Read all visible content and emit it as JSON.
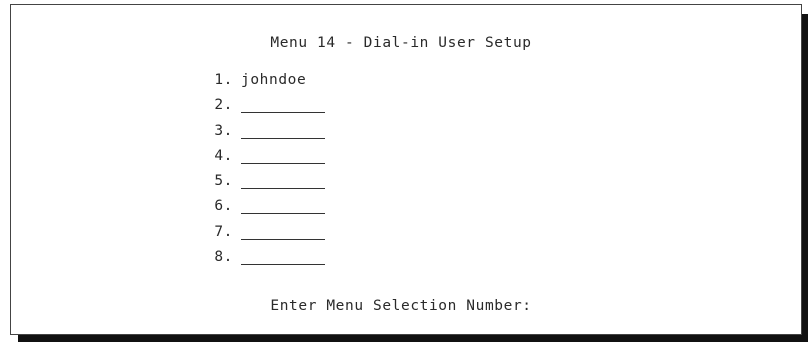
{
  "screen": {
    "title": "Menu 14 - Dial-in User Setup",
    "users": [
      {
        "number": "1.",
        "name": "johndoe"
      },
      {
        "number": "2.",
        "name": ""
      },
      {
        "number": "3.",
        "name": ""
      },
      {
        "number": "4.",
        "name": ""
      },
      {
        "number": "5.",
        "name": ""
      },
      {
        "number": "6.",
        "name": ""
      },
      {
        "number": "7.",
        "name": ""
      },
      {
        "number": "8.",
        "name": ""
      }
    ],
    "prompt": "Enter Menu Selection Number:"
  }
}
